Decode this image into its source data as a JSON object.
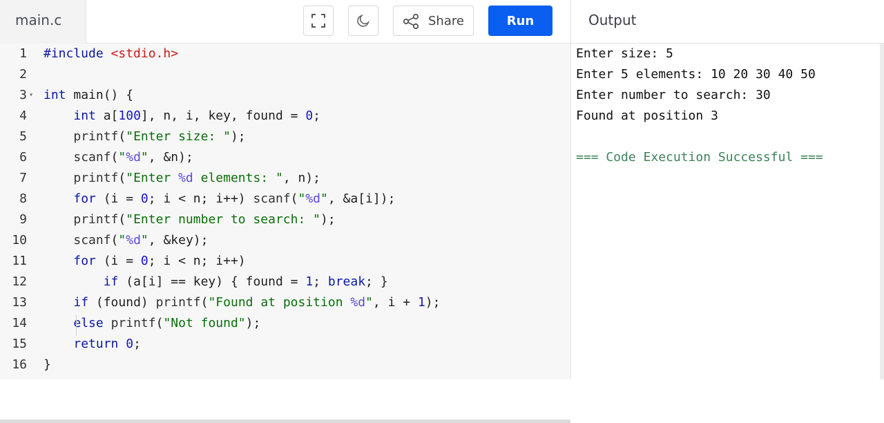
{
  "file_tab": {
    "label": "main.c"
  },
  "toolbar": {
    "fullscreen_icon": "fullscreen-icon",
    "theme_icon": "moon-icon",
    "share_label": "Share",
    "share_icon": "share-icon",
    "run_label": "Run",
    "run_color": "#0a5ef0"
  },
  "output_panel": {
    "title": "Output"
  },
  "editor": {
    "lines": [
      {
        "n": "1",
        "html": "<span class='kw'>#include</span> <span class='inc'>&lt;stdio.h&gt;</span>"
      },
      {
        "n": "2",
        "html": ""
      },
      {
        "n": "3",
        "html": "<span class='kw'>int</span> main() {",
        "fold": true
      },
      {
        "n": "4",
        "html": "    <span class='kw'>int</span> a[<span class='num'>100</span>], n, i, key, found = <span class='num'>0</span>;"
      },
      {
        "n": "5",
        "html": "    <span class='fn'>printf</span>(<span class='str'>\"Enter size: \"</span>);"
      },
      {
        "n": "6",
        "html": "    <span class='fn'>scanf</span>(<span class='str'>\"<span class='fmt'>%d</span>\"</span>, &amp;n);"
      },
      {
        "n": "7",
        "html": "    <span class='fn'>printf</span>(<span class='str'>\"Enter <span class='fmt'>%d</span> elements: \"</span>, n);"
      },
      {
        "n": "8",
        "html": "    <span class='kw'>for</span> (i = <span class='num'>0</span>; i &lt; n; i++) <span class='fn'>scanf</span>(<span class='str'>\"<span class='fmt'>%d</span>\"</span>, &amp;a[i]);"
      },
      {
        "n": "9",
        "html": "    <span class='fn'>printf</span>(<span class='str'>\"Enter number to search: \"</span>);"
      },
      {
        "n": "10",
        "html": "    <span class='fn'>scanf</span>(<span class='str'>\"<span class='fmt'>%d</span>\"</span>, &amp;key);"
      },
      {
        "n": "11",
        "html": "    <span class='kw'>for</span> (i = <span class='num'>0</span>; i &lt; n; i++)"
      },
      {
        "n": "12",
        "html": "        <span class='kw'>if</span> (a[i] == key) { found = <span class='num'>1</span>; <span class='kw'>break</span>; }"
      },
      {
        "n": "13",
        "html": "    <span class='kw'>if</span> (found) <span class='fn'>printf</span>(<span class='str'>\"Found at position <span class='fmt'>%d</span>\"</span>, i + <span class='num'>1</span>);"
      },
      {
        "n": "14",
        "html": "    <span class='kw'>else</span> <span class='fn'>printf</span>(<span class='str'>\"Not found\"</span>);"
      },
      {
        "n": "15",
        "html": "    <span class='kw'>return</span> <span class='num'>0</span>;"
      },
      {
        "n": "16",
        "html": "}"
      }
    ]
  },
  "output": {
    "lines": [
      {
        "text": "Enter size: 5"
      },
      {
        "text": "Enter 5 elements: 10 20 30 40 50"
      },
      {
        "text": "Enter number to search: 30"
      },
      {
        "text": "Found at position 3"
      },
      {
        "text": ""
      },
      {
        "text": "=== Code Execution Successful ===",
        "success": true
      }
    ]
  }
}
